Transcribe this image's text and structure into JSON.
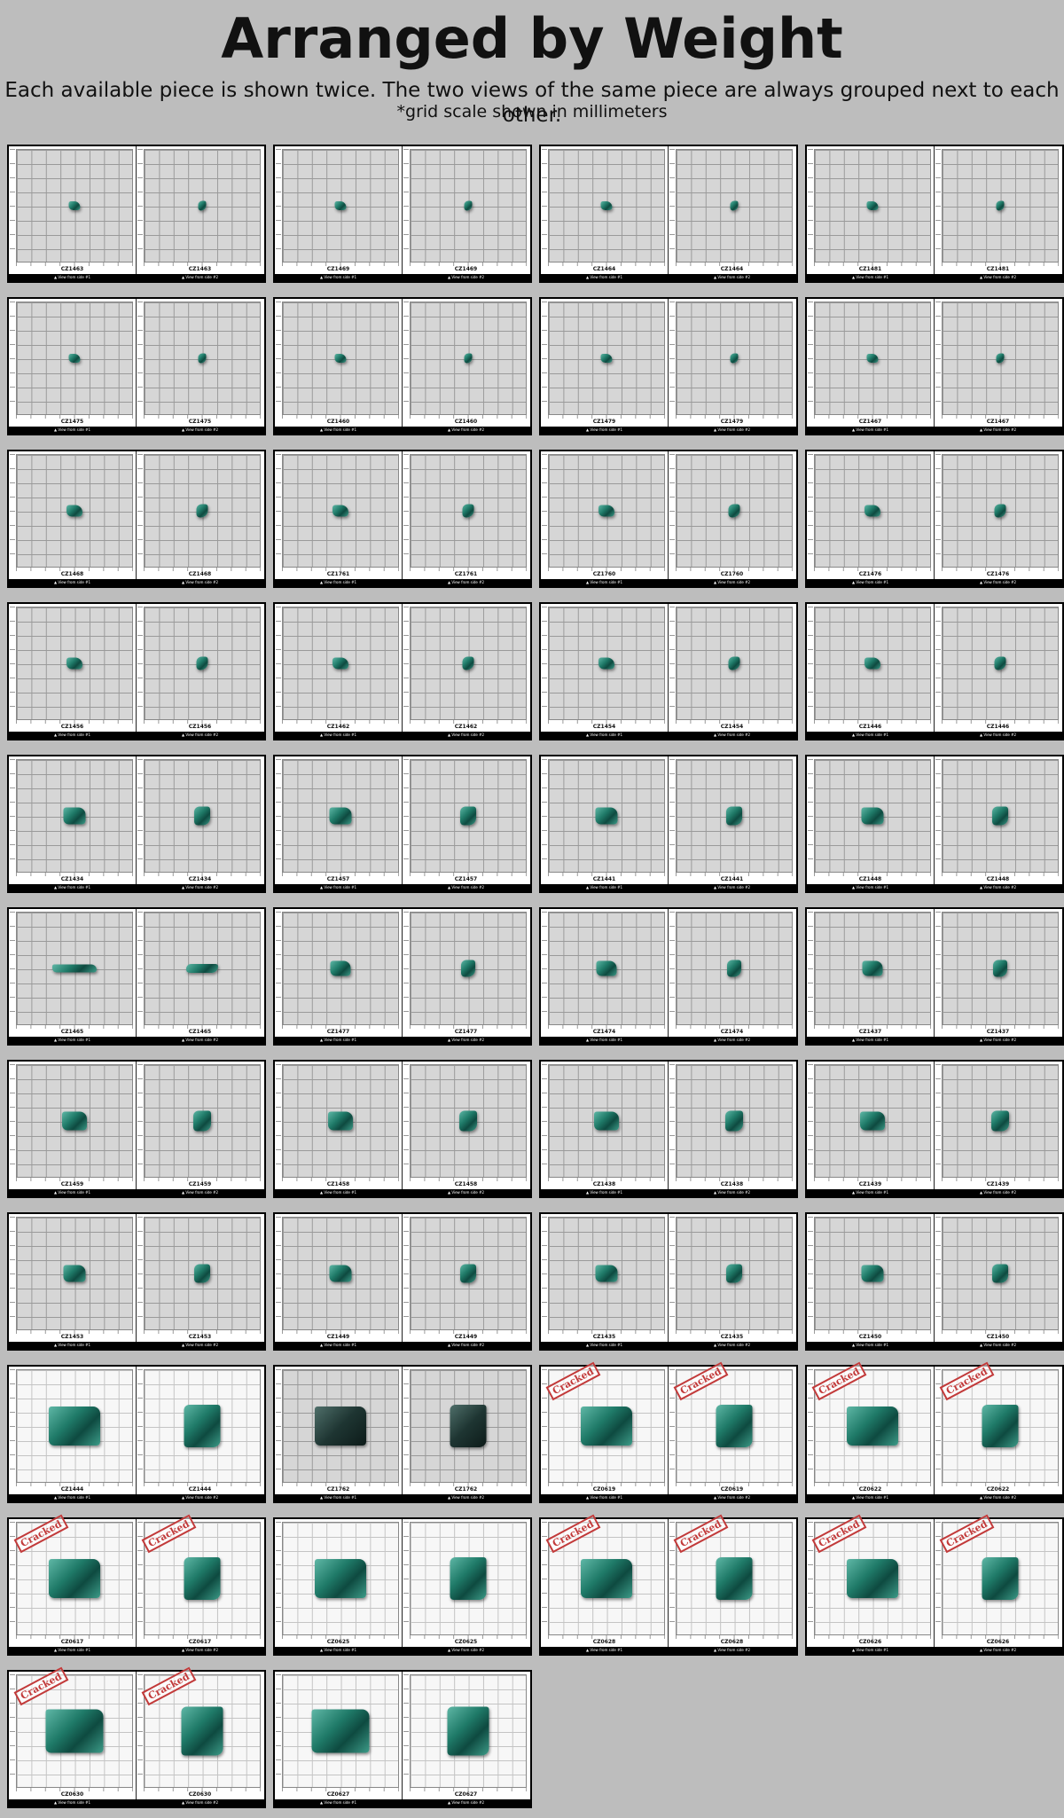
{
  "header": {
    "title": "Arranged by Weight",
    "subtitle": "Each available piece is shown twice. The two views of the same piece are always grouped next to each other.",
    "note": "*grid scale shown in millimeters"
  },
  "stamp_label": "Cracked",
  "caption_side1": "▲ View from side #1",
  "caption_side2": "▲ View from side #2",
  "colors": {
    "page_background": "#bdbdbd",
    "stamp": "#c23a3a",
    "stone": "#1f7a68"
  },
  "pieces": [
    {
      "id": "CZ1463",
      "cracked": false
    },
    {
      "id": "CZ1469",
      "cracked": false
    },
    {
      "id": "CZ1464",
      "cracked": false
    },
    {
      "id": "CZ1481",
      "cracked": false
    },
    {
      "id": "CZ1475",
      "cracked": false
    },
    {
      "id": "CZ1460",
      "cracked": false
    },
    {
      "id": "CZ1479",
      "cracked": false
    },
    {
      "id": "CZ1467",
      "cracked": false
    },
    {
      "id": "CZ1468",
      "cracked": false
    },
    {
      "id": "CZ1761",
      "cracked": false
    },
    {
      "id": "CZ1760",
      "cracked": false
    },
    {
      "id": "CZ1476",
      "cracked": false
    },
    {
      "id": "CZ1456",
      "cracked": false
    },
    {
      "id": "CZ1462",
      "cracked": false
    },
    {
      "id": "CZ1454",
      "cracked": false
    },
    {
      "id": "CZ1446",
      "cracked": false
    },
    {
      "id": "CZ1434",
      "cracked": false
    },
    {
      "id": "CZ1457",
      "cracked": false
    },
    {
      "id": "CZ1441",
      "cracked": false
    },
    {
      "id": "CZ1448",
      "cracked": false
    },
    {
      "id": "CZ1465",
      "cracked": false
    },
    {
      "id": "CZ1477",
      "cracked": false
    },
    {
      "id": "CZ1474",
      "cracked": false
    },
    {
      "id": "CZ1437",
      "cracked": false
    },
    {
      "id": "CZ1459",
      "cracked": false
    },
    {
      "id": "CZ1458",
      "cracked": false
    },
    {
      "id": "CZ1438",
      "cracked": false
    },
    {
      "id": "CZ1439",
      "cracked": false
    },
    {
      "id": "CZ1453",
      "cracked": false
    },
    {
      "id": "CZ1449",
      "cracked": false
    },
    {
      "id": "CZ1435",
      "cracked": false
    },
    {
      "id": "CZ1450",
      "cracked": false
    },
    {
      "id": "CZ1444",
      "cracked": false
    },
    {
      "id": "CZ1762",
      "cracked": false
    },
    {
      "id": "CZ0619",
      "cracked": true
    },
    {
      "id": "CZ0622",
      "cracked": true
    },
    {
      "id": "CZ0617",
      "cracked": true
    },
    {
      "id": "CZ0625",
      "cracked": false
    },
    {
      "id": "CZ0628",
      "cracked": true
    },
    {
      "id": "CZ0626",
      "cracked": true
    },
    {
      "id": "CZ0630",
      "cracked": true
    },
    {
      "id": "CZ0627",
      "cracked": false
    }
  ]
}
